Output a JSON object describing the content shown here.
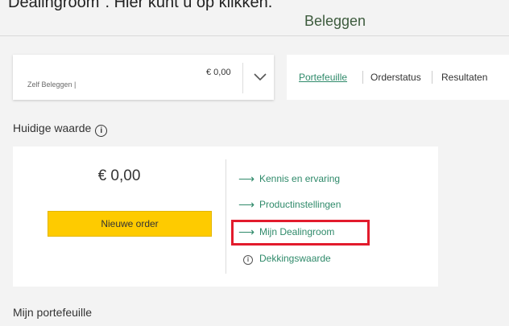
{
  "caption": "Dealingroom\". Hier kunt u op klikken.",
  "header": {
    "title": "Beleggen"
  },
  "account": {
    "name": "Zelf Beleggen   |",
    "amount": "€ 0,00"
  },
  "tabs": [
    {
      "label": "Portefeuille",
      "active": true
    },
    {
      "label": "Orderstatus",
      "active": false
    },
    {
      "label": "Resultaten",
      "active": false
    }
  ],
  "current_value": {
    "title": "Huidige waarde",
    "amount": "€ 0,00",
    "order_button": "Nieuwe order",
    "links": [
      {
        "label": "Kennis en ervaring",
        "icon": "arrow-right-icon"
      },
      {
        "label": "Productinstellingen",
        "icon": "arrow-right-icon"
      },
      {
        "label": "Mijn Dealingroom",
        "icon": "arrow-right-icon"
      },
      {
        "label": "Dekkingswaarde",
        "icon": "info-icon"
      }
    ]
  },
  "portfolio": {
    "title": "Mijn portefeuille"
  },
  "colors": {
    "accent_green": "#2f8a6a",
    "button_yellow": "#fecb00",
    "highlight_red": "#e21b2c"
  }
}
